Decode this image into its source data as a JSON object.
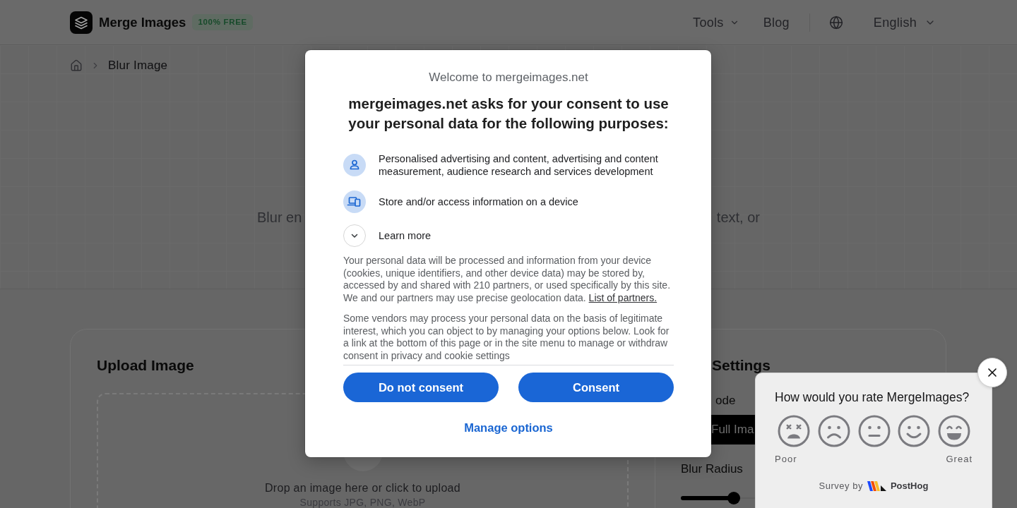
{
  "header": {
    "logo_text": "Merge Images",
    "badge": "100% FREE",
    "nav": [
      {
        "label": "Tools",
        "kind": "dropdown"
      },
      {
        "label": "Blog",
        "kind": "link"
      }
    ],
    "language": {
      "label": "English"
    }
  },
  "breadcrumb": {
    "current": "Blur Image"
  },
  "hero": {
    "subtitle_left": "Blur en",
    "subtitle_right": "text, or"
  },
  "upload_panel": {
    "title": "Upload Image",
    "drop_text": "Drop an image here or click to upload",
    "formats": "Supports JPG, PNG, WebP"
  },
  "settings_panel": {
    "title": "Settings",
    "mode_label": "ode",
    "mode_button": {
      "label": "Full Ima",
      "selected": true
    },
    "radius_label": "Blur Radius",
    "radius_slider": {
      "level": 0.22
    }
  },
  "consent_dialog": {
    "welcome": "Welcome to mergeimages.net",
    "title": "mergeimages.net asks for your consent to use your personal data for the following purposes:",
    "purposes": [
      {
        "kind": "person",
        "text": "Personalised advertising and content, advertising and content measurement, audience research and services development"
      },
      {
        "kind": "device",
        "text": "Store and/or access information on a device"
      }
    ],
    "learn_more": {
      "label": "Learn more",
      "expanded": false
    },
    "paragraphs": [
      {
        "text": "Your personal data will be processed and information from your device (cookies, unique identifiers, and other device data) may be stored by, accessed by and shared with 210 partners, or used specifically by this site. We and our partners may use precise geolocation data.",
        "link": "List of partners."
      },
      {
        "text": "Some vendors may process your personal data on the basis of legitimate interest, which you can object to by managing your options below. Look for a link at the bottom of this page or in the site menu to manage or withdraw consent in privacy and cookie settings"
      }
    ],
    "buttons": [
      "Do not consent",
      "Consent"
    ],
    "manage_link": "Manage options"
  },
  "survey": {
    "question": "How would you rate MergeImages?",
    "ratings": [
      {
        "kind": "dizzy",
        "selected": false
      },
      {
        "kind": "sad",
        "selected": false
      },
      {
        "kind": "neutral",
        "selected": false
      },
      {
        "kind": "smile",
        "selected": false
      },
      {
        "kind": "grin",
        "selected": false
      }
    ],
    "low_label": "Poor",
    "high_label": "Great",
    "footer_prefix": "Survey by",
    "footer_brand": "PostHog"
  }
}
